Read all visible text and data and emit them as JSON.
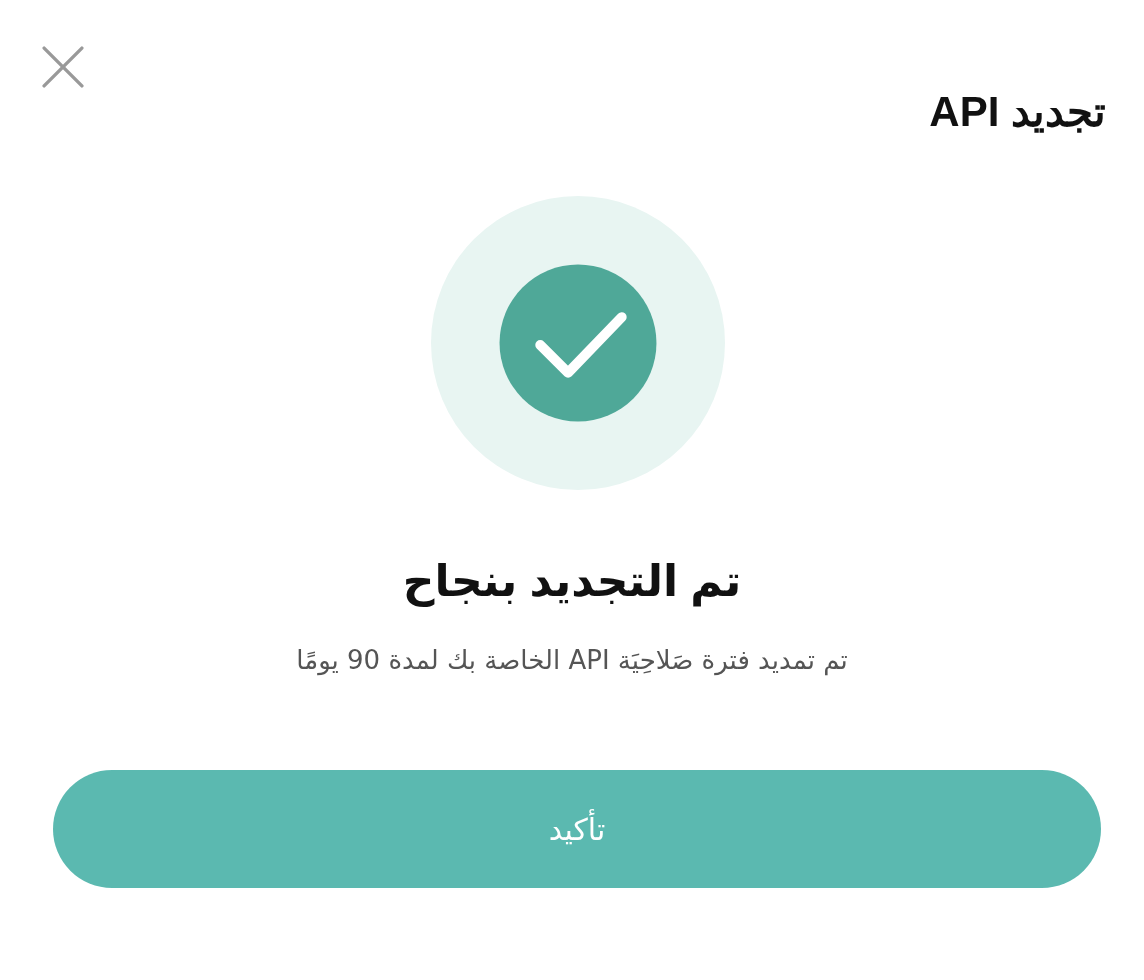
{
  "dialog": {
    "title": "تجديد API"
  },
  "result": {
    "kind": "success",
    "heading": "تم التجديد بنجاح",
    "message": "تم تمديد فترة صَلاحِيَة API الخاصة بك لمدة 90 يومًا"
  },
  "buttons": [
    {
      "label": "تأكيد"
    }
  ]
}
